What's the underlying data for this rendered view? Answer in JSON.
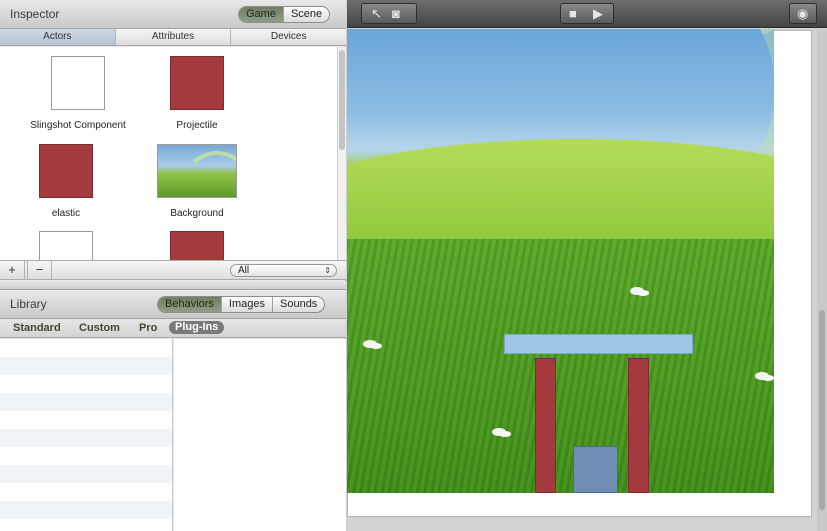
{
  "inspector": {
    "title": "Inspector",
    "mode_toggle": [
      "Game",
      "Scene"
    ],
    "active_mode": "Game",
    "tabs": [
      "Actors",
      "Attributes",
      "Devices"
    ],
    "active_tab": "Actors",
    "actors": [
      {
        "label": "Slingshot Component",
        "thumb": "white"
      },
      {
        "label": "Projectile",
        "thumb": "red"
      },
      {
        "label": "elastic",
        "thumb": "red"
      },
      {
        "label": "Background",
        "thumb": "background-image"
      },
      {
        "label": "",
        "thumb": "white"
      },
      {
        "label": "",
        "thumb": "red"
      }
    ],
    "add_button": "+",
    "remove_button": "−",
    "filter": {
      "value": "All",
      "arrow": "⇕"
    }
  },
  "library": {
    "title": "Library",
    "mode_toggle": [
      "Behaviors",
      "Images",
      "Sounds"
    ],
    "active_mode": "Behaviors",
    "tabs": [
      "Standard",
      "Custom",
      "Pro",
      "Plug-Ins"
    ],
    "active_tab": "Plug-Ins"
  },
  "toolbar": {
    "icons": [
      "arrow-pointer-icon",
      "camera-icon",
      "stop-icon",
      "play-icon",
      "view-toggle-icon"
    ],
    "stop_glyph": "■",
    "play_glyph": "▶",
    "pointer_glyph": "↖",
    "camera_glyph": "◙",
    "view_glyph": "◉"
  },
  "colors": {
    "accent_green": "#7a8a6d",
    "actor_red": "#a33a3e",
    "beam_blue": "#9ec6e6",
    "box_blue": "#6f8db2"
  }
}
